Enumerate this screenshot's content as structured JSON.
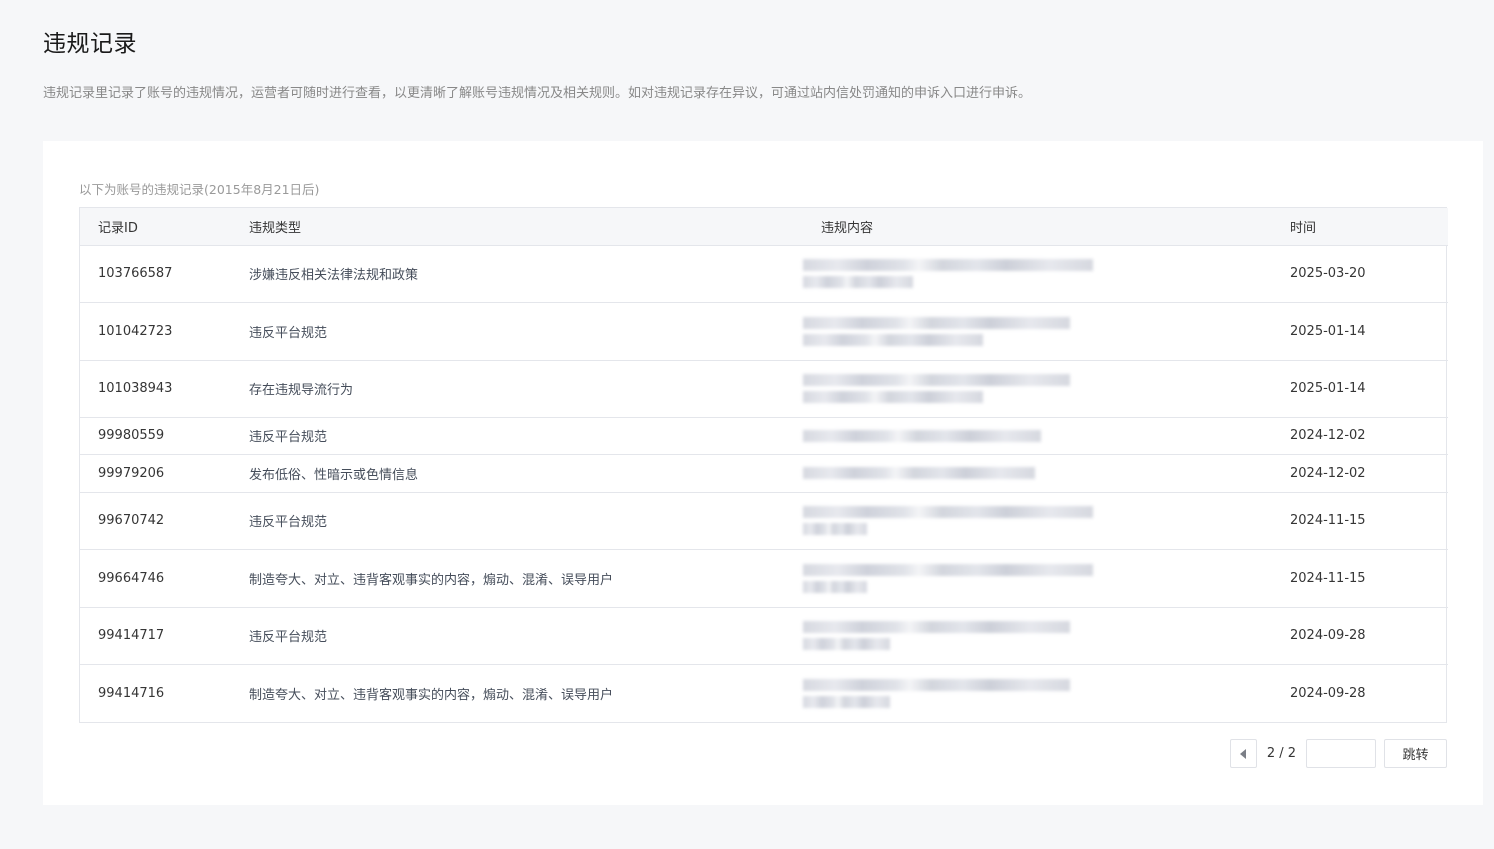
{
  "page": {
    "title": "违规记录",
    "description": "违规记录里记录了账号的违规情况，运营者可随时进行查看，以更清晰了解账号违规情况及相关规则。如对违规记录存在异议，可通过站内信处罚通知的申诉入口进行申诉。"
  },
  "table": {
    "caption": "以下为账号的违规记录(2015年8月21日后)",
    "headers": [
      "记录ID",
      "违规类型",
      "违规内容",
      "时间"
    ],
    "rows": [
      {
        "id": "103766587",
        "type": "涉嫌违反相关法律法规和政策",
        "date": "2025-03-20"
      },
      {
        "id": "101042723",
        "type": "违反平台规范",
        "date": "2025-01-14"
      },
      {
        "id": "101038943",
        "type": "存在违规导流行为",
        "date": "2025-01-14"
      },
      {
        "id": "99980559",
        "type": "违反平台规范",
        "date": "2024-12-02"
      },
      {
        "id": "99979206",
        "type": "发布低俗、性暗示或色情信息",
        "date": "2024-12-02"
      },
      {
        "id": "99670742",
        "type": "违反平台规范",
        "date": "2024-11-15"
      },
      {
        "id": "99664746",
        "type": "制造夸大、对立、违背客观事实的内容，煽动、混淆、误导用户",
        "date": "2024-11-15"
      },
      {
        "id": "99414717",
        "type": "违反平台规范",
        "date": "2024-09-28"
      },
      {
        "id": "99414716",
        "type": "制造夸大、对立、违背客观事实的内容，煽动、混淆、误导用户",
        "date": "2024-09-28"
      }
    ]
  },
  "pagination": {
    "page_info": "2 / 2",
    "jump_input_value": "",
    "jump_label": "跳转",
    "prev_icon": "caret-left-icon"
  }
}
